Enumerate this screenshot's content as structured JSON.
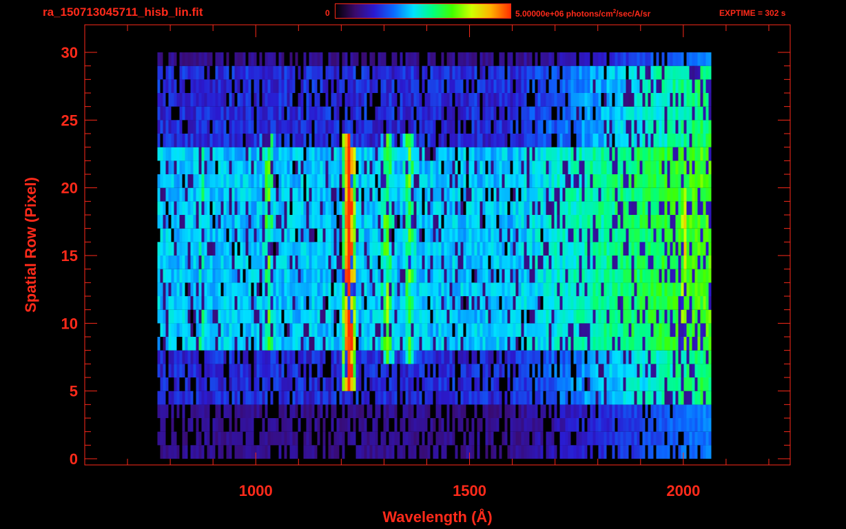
{
  "header": {
    "filename": "ra_150713045711_hisb_lin.fit",
    "colorbar_min": "0",
    "colorbar_max_prefix": "5.00000e+06 photons/cm",
    "colorbar_max_sup": "2",
    "colorbar_max_suffix": "/sec/A/sr",
    "exptime": "EXPTIME = 302 s"
  },
  "colors": {
    "axis": "#ff2a1a",
    "background": "#000000",
    "colormap": [
      "#000000",
      "#3a0a6a",
      "#2a1ad0",
      "#0a6aff",
      "#00e0ff",
      "#00ff80",
      "#40ff00",
      "#d0ff00",
      "#ffb000",
      "#ff3000"
    ]
  },
  "chart_data": {
    "type": "heatmap",
    "title": "",
    "xlabel": "Wavelength (Å)",
    "ylabel": "Spatial Row (Pixel)",
    "xlim": [
      600,
      2250
    ],
    "ylim": [
      0,
      30
    ],
    "xticks": [
      1000,
      1500,
      2000
    ],
    "yticks": [
      0,
      5,
      10,
      15,
      20,
      25,
      30
    ],
    "color_scale": [
      0,
      5000000
    ],
    "data_extent": {
      "x": [
        770,
        2060
      ],
      "y": [
        0,
        30
      ]
    },
    "features": [
      {
        "wavelength": 1216,
        "rows": [
          5,
          24
        ],
        "relative_intensity": 1.0
      },
      {
        "wavelength": 1304,
        "rows": [
          7,
          24
        ],
        "relative_intensity": 0.55
      },
      {
        "wavelength": 1356,
        "rows": [
          7,
          24
        ],
        "relative_intensity": 0.5
      },
      {
        "wavelength": 1026,
        "rows": [
          8,
          24
        ],
        "relative_intensity": 0.5
      },
      {
        "wavelength": 870,
        "rows": [
          8,
          23
        ],
        "relative_intensity": 0.4
      },
      {
        "wavelength": 2000,
        "rows": [
          8,
          20
        ],
        "relative_intensity": 0.65
      }
    ]
  }
}
